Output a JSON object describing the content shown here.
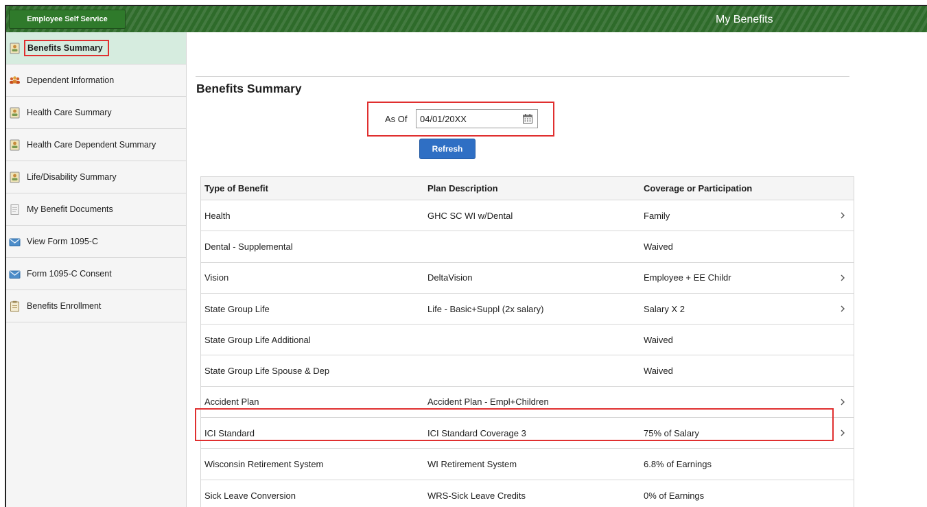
{
  "header": {
    "ess_button": "Employee Self Service",
    "page_title": "My Benefits",
    "brand_color": "#2e6b2a"
  },
  "sidebar": {
    "items": [
      {
        "label": "Benefits Summary",
        "icon": "person-doc-icon",
        "active": true
      },
      {
        "label": "Dependent Information",
        "icon": "people-group-icon"
      },
      {
        "label": "Health Care Summary",
        "icon": "person-doc-icon"
      },
      {
        "label": "Health Care Dependent Summary",
        "icon": "person-doc-icon"
      },
      {
        "label": "Life/Disability Summary",
        "icon": "person-doc-icon"
      },
      {
        "label": "My Benefit Documents",
        "icon": "document-icon"
      },
      {
        "label": "View Form 1095-C",
        "icon": "envelope-form-icon"
      },
      {
        "label": "Form 1095-C Consent",
        "icon": "envelope-form-icon"
      },
      {
        "label": "Benefits Enrollment",
        "icon": "clipboard-icon"
      }
    ]
  },
  "main": {
    "title": "Benefits Summary",
    "as_of_label": "As Of",
    "as_of_value": "04/01/20XX",
    "refresh_label": "Refresh",
    "columns": [
      "Type of Benefit",
      "Plan Description",
      "Coverage or Participation"
    ],
    "rows": [
      {
        "type": "Health",
        "plan": "GHC SC WI w/Dental",
        "coverage": "Family",
        "has_detail": true
      },
      {
        "type": "Dental - Supplemental",
        "plan": "",
        "coverage": "Waived",
        "has_detail": false
      },
      {
        "type": "Vision",
        "plan": "DeltaVision",
        "coverage": "Employee + EE Childr",
        "has_detail": true
      },
      {
        "type": "State Group Life",
        "plan": "Life - Basic+Suppl (2x salary)",
        "coverage": "Salary X 2",
        "has_detail": true
      },
      {
        "type": "State Group Life Additional",
        "plan": "",
        "coverage": "Waived",
        "has_detail": false
      },
      {
        "type": "State Group Life Spouse & Dep",
        "plan": "",
        "coverage": "Waived",
        "has_detail": false
      },
      {
        "type": "Accident Plan",
        "plan": "Accident Plan - Empl+Children",
        "coverage": "",
        "has_detail": true
      },
      {
        "type": "ICI Standard",
        "plan": "ICI Standard Coverage 3",
        "coverage": "75% of Salary",
        "has_detail": true
      },
      {
        "type": "Wisconsin Retirement System",
        "plan": "WI Retirement System",
        "coverage": "6.8% of Earnings",
        "has_detail": false
      },
      {
        "type": "Sick Leave Conversion",
        "plan": "WRS-Sick Leave Credits",
        "coverage": "0% of Earnings",
        "has_detail": false
      }
    ]
  },
  "colors": {
    "accent_button": "#2f6fc4",
    "active_sidebar": "#d6ecdf",
    "highlight_box": "#e02f2f"
  }
}
